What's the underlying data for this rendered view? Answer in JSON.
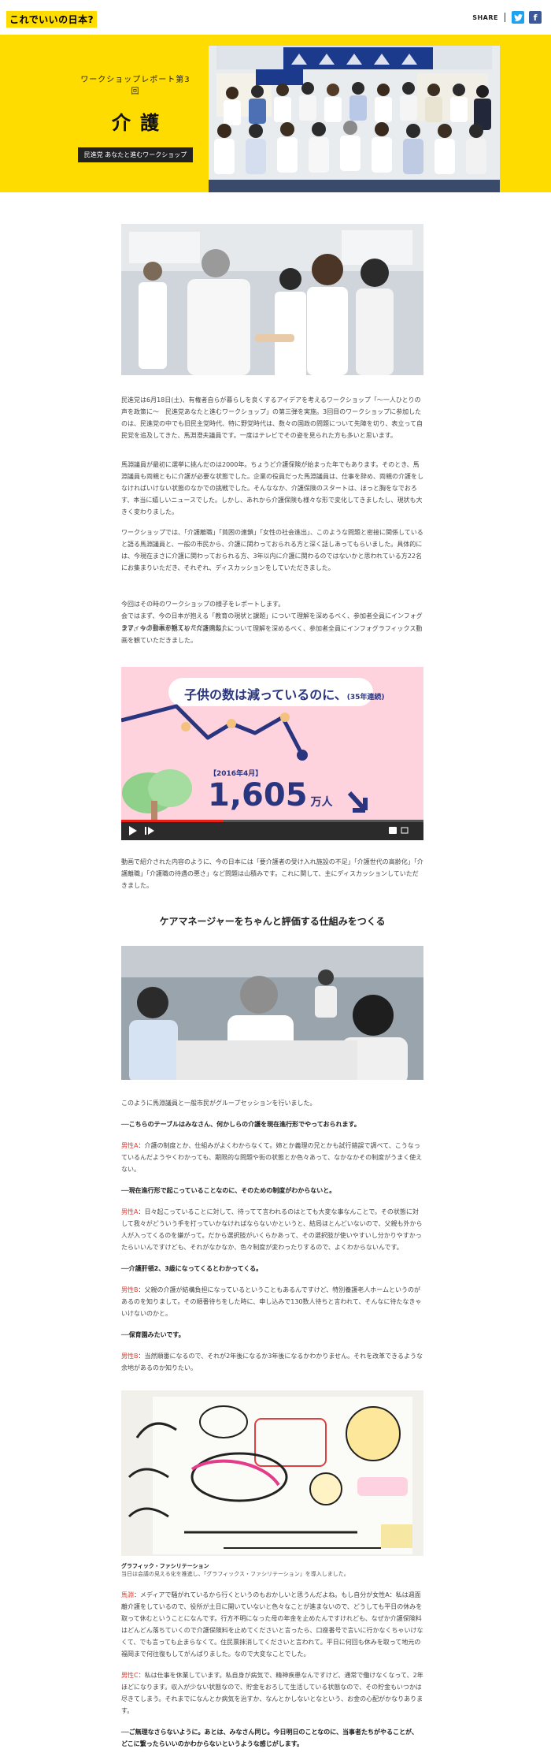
{
  "header": {
    "logo": "これでいいの日本?",
    "share_label": "SHARE",
    "twitter_icon": "twitter-icon",
    "facebook_icon": "facebook-icon"
  },
  "hero": {
    "subtitle": "ワークショップレポート第3回",
    "title": "介護",
    "tag": "民進党 あなたと進むワークショップ"
  },
  "intro": [
    "民進党は6月18日(土)、有権者自らが暮らしを良くするアイデアを考えるワークショップ「〜一人ひとりの声を政策に〜　民進党あなたと進むワークショップ」の第三弾を実施。3回目のワークショップに参加したのは、民進党の中でも旧民主党時代、特に野党時代は、数々の国政の問題について先陣を切り、表立って自民党を追及してきた、馬淵澄夫議員です。一度はテレビでその姿を見られた方も多いと思います。",
    "馬淵議員が最初に選挙に挑んだのは2000年。ちょうど介護保険が始まった年でもあります。そのとき、馬淵議員も両親ともに介護が必要な状態でした。企業の役員だった馬淵議員は、仕事を辞め、両親の介護をしなければいけない状態のなかでの挑戦でした。そんななか、介護保険のスタートは、ほっと胸をなでおろす、本当に嬉しいニュースでした。しかし、あれから介護保険も様々な形で変化してきましたし、現状も大きく変わりました。",
    "ワークショップでは、「介護離職」「貧困の連鎖」「女性の社会進出」、このような問題と密接に関係していると語る馬淵議員と、一般の市民から、介護に関わっておられる方と深く話しあってもらいました。具体的には、今現在まさに介護に関わっておられる方、3年以内に介護に関わるのではないかと思われている方22名にお集まりいただき、それぞれ、ディスカッションをしていただきました。",
    "今回はその時のワークショップの様子をレポートします。\n会ではまず、今の日本が抱える「教育の現状と課題」について理解を深めるべく、参加者全員にインフォグラフィック動画を観ていただきました。",
    "まず、今の日本が抱える「介護問題」について理解を深めるべく、参加者全員にインフォグラフィックス動画を観ていただきました。"
  ],
  "video": {
    "headline": "子供の数は減っているのに、",
    "headline_suffix": "(35年連続)",
    "date_label": "【2016年4月】",
    "number": "1,605",
    "unit": "万人"
  },
  "after_video": "動画で紹介された内容のように、今の日本には「要介護者の受け入れ施設の不足」「介護世代の高齢化」「介護離職」「介護職の待遇の悪さ」など問題は山積みです。これに関して、主にディスカッションしていただきました。",
  "section_heading": "ケアマネージャーをちゃんと評価する仕組みをつくる",
  "dialogue_intro": "このように馬淵議員と一般市民がグループセッションを行いました。",
  "dialogue": [
    {
      "type": "q",
      "text": "──こちらのテーブルはみなさん、何かしらの介護を現在進行形でやっておられます。"
    },
    {
      "type": "a",
      "speaker": "男性A",
      "text": "：介護の制度とか、仕組みがよくわからなくて。姉とか義理の兄とかも試行錯誤で調べて、こうなっているんだようやくわかっても、期限的な問題や街の状態とか色々あって、なかなかその制度がうまく使えない。"
    },
    {
      "type": "q",
      "text": "──現在進行形で起こっていることなのに、そのための制度がわからないと。"
    },
    {
      "type": "a",
      "speaker": "男性A",
      "text": "：日々起こっていることに対して、待ってて言われるのはとても大変な事なんことで。その状態に対して我々がどういう手を打っていかなければならないかというと、結局ほとんどいないので、父親も外から人が入ってくるのを嫌がって。だから選択肢がいくらかあって、その選択肢が使いやすいし分かりやすかったらいいんですけども、それがなかなか、色々制度が変わったりするので、よくわからないんです。"
    },
    {
      "type": "q",
      "text": "──介護肝領2、3歳になってくるとわかってくる。"
    },
    {
      "type": "a",
      "speaker": "男性B",
      "text": "：父親の介護が結構負担になっているということもあるんですけど、特別養護老人ホームというのがあるのを知りまして。その順番待ちをした時に、申し込みで130数人待ちと言われて、そんなに待たなきゃいけないのかと。"
    },
    {
      "type": "q",
      "text": "──保育園みたいです。"
    },
    {
      "type": "a",
      "speaker": "男性B",
      "text": "：当然順番になるので、それが2年後になるか3年後になるかわかりません。それを改革できるような余地があるのか知りたい。"
    }
  ],
  "caption": {
    "title": "グラフィック・ファシリテーション",
    "sub": "当日は会議の見える化を推進し、「グラフィックス・ファシリテーション」を導入しました。"
  },
  "after_caption": [
    {
      "speaker": "馬淵",
      "text": "：メディアで騒がれているから行くというのもおかしいと思うんだよね。もし自分が女性A：私は週面離介護をしているので、役所が土日に開いていないと色々なことが進まないので、どうしても平日の休みを取って休むということになんです。行方不明になった母の年金を止めたんですけれども、なぜか介護保険料はどんどん落ちていくので介護保険料を止めてくださいと言ったら、口座番号で言いに行かなくちゃいけなくて、でも言っても止まらなくて。住民票抹消してくださいと言われて。平日に何回も休みを取って地元の福岡まで何往復もしてがんばりました。なので大変なことでした。"
    },
    {
      "speaker": "男性C",
      "text": "：私は仕事を休業しています。私自身が病気で、精神疾患なんですけど、通常で働けなくなって、2年ほどになります。収入が少ない状態なので、貯金をおろして生活している状態なので、その貯金もいつかは尽きてしまう。それまでになんとか病気を治すか、なんとかしないとなという、お金の心配がかなりあります。"
    }
  ],
  "final_q": "──ご無理なさらないように。あとは、みなさん同じ。今日明日のことなのに、当事者たちがやることが、どこに繋ったらいいのかわからないというような感じがします。"
}
